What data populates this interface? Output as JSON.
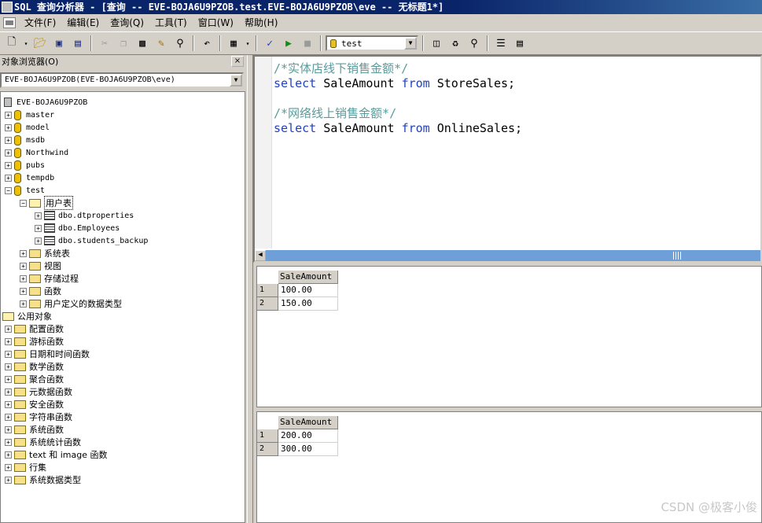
{
  "window": {
    "title": "SQL 查询分析器 - [查询 -- EVE-BOJA6U9PZOB.test.EVE-BOJA6U9PZOB\\eve -- 无标题1*]"
  },
  "menu": {
    "items": [
      "文件(F)",
      "编辑(E)",
      "查询(Q)",
      "工具(T)",
      "窗口(W)",
      "帮助(H)"
    ]
  },
  "toolbar": {
    "database_selected": "test"
  },
  "object_browser": {
    "title": "对象浏览器(O)",
    "close_label": "×",
    "server_combo": "EVE-BOJA6U9PZOB(EVE-BOJA6U9PZOB\\eve)",
    "server": "EVE-BOJA6U9PZOB",
    "databases": [
      "master",
      "model",
      "msdb",
      "Northwind",
      "pubs",
      "tempdb",
      "test"
    ],
    "test_children": {
      "user_tables_folder": "用户表",
      "tables": [
        "dbo.dtproperties",
        "dbo.Employees",
        "dbo.students_backup"
      ],
      "other_folders": [
        "系统表",
        "视图",
        "存储过程",
        "函数",
        "用户定义的数据类型"
      ]
    },
    "common_objects": "公用对象",
    "common_children": [
      "配置函数",
      "游标函数",
      "日期和时间函数",
      "数学函数",
      "聚合函数",
      "元数据函数",
      "安全函数",
      "字符串函数",
      "系统函数",
      "系统统计函数",
      "text 和 image 函数",
      "行集",
      "系统数据类型"
    ]
  },
  "editor": {
    "lines": [
      {
        "comment": "/*实体店线下销售金额*/"
      },
      {
        "kw1": "select",
        "t1": " SaleAmount ",
        "kw2": "from",
        "t2": " StoreSales;"
      },
      {
        "blank": ""
      },
      {
        "comment": "/*网络线上销售金额*/"
      },
      {
        "kw1": "select",
        "t1": " SaleAmount ",
        "kw2": "from",
        "t2": " OnlineSales;"
      }
    ]
  },
  "results": [
    {
      "column": "SaleAmount",
      "rows": [
        {
          "n": "1",
          "v": "100.00"
        },
        {
          "n": "2",
          "v": "150.00"
        }
      ]
    },
    {
      "column": "SaleAmount",
      "rows": [
        {
          "n": "1",
          "v": "200.00"
        },
        {
          "n": "2",
          "v": "300.00"
        }
      ]
    }
  ],
  "watermark": "CSDN @极客小俊",
  "icons": [
    "new-query-icon",
    "open-icon",
    "save-icon",
    "cut-icon",
    "copy-icon",
    "paste-icon",
    "find-icon",
    "undo-icon",
    "grid-icon",
    "parse-icon",
    "execute-icon",
    "stop-icon",
    "object-browser-icon",
    "object-search-icon",
    "options-icon"
  ]
}
